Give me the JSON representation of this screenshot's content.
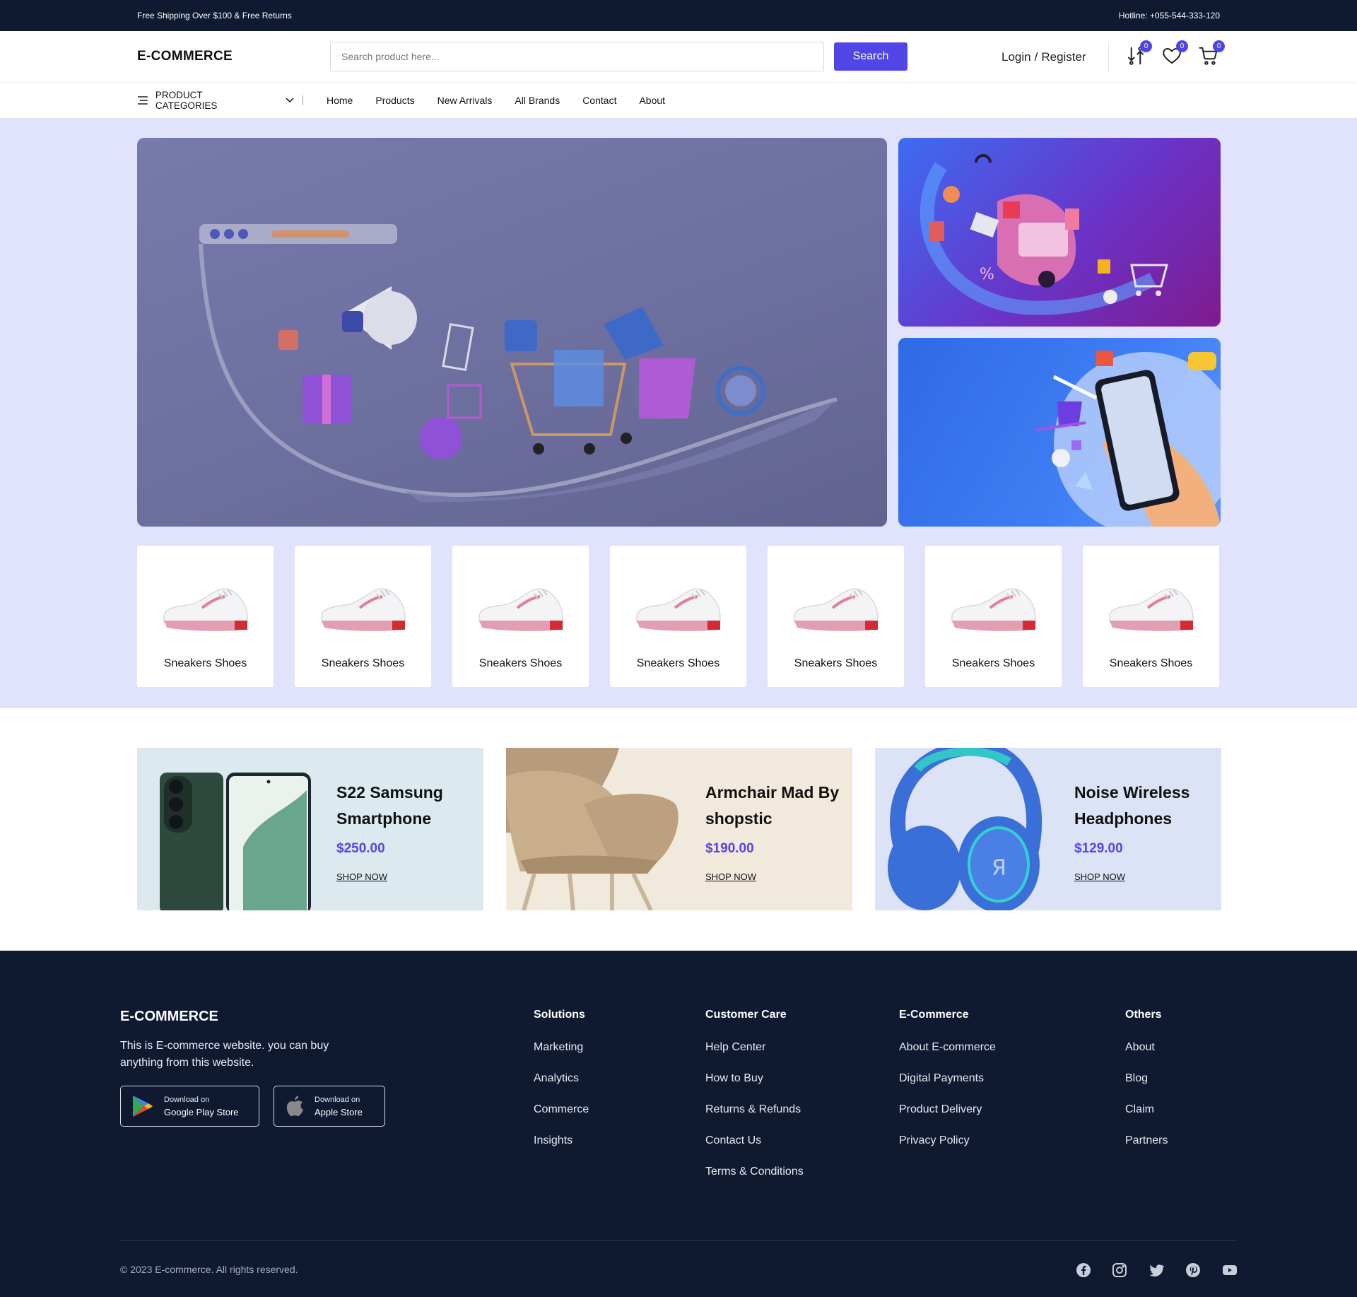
{
  "topbar": {
    "promo": "Free Shipping Over $100 & Free Returns",
    "hotline": "Hotline: +055-544-333-120"
  },
  "header": {
    "logo": "E-COMMERCE",
    "search_placeholder": "Search product here...",
    "search_button": "Search",
    "login": "Login",
    "register": "Register",
    "compare_count": "0",
    "wishlist_count": "0",
    "cart_count": "0"
  },
  "nav": {
    "categories": "PRODUCT CATEGORIES",
    "links": [
      "Home",
      "Products",
      "New Arrivals",
      "All Brands",
      "Contact",
      "About"
    ]
  },
  "category_cards": [
    {
      "label": "Sneakers Shoes"
    },
    {
      "label": "Sneakers Shoes"
    },
    {
      "label": "Sneakers Shoes"
    },
    {
      "label": "Sneakers Shoes"
    },
    {
      "label": "Sneakers Shoes"
    },
    {
      "label": "Sneakers Shoes"
    },
    {
      "label": "Sneakers Shoes"
    }
  ],
  "promos": [
    {
      "title": "S22 Samsung Smartphone",
      "price": "$250.00",
      "cta": "SHOP NOW",
      "bg": "#dceaf0"
    },
    {
      "title": "Armchair Mad By shopstic",
      "price": "$190.00",
      "cta": "SHOP NOW",
      "bg": "#f2e9dd"
    },
    {
      "title": "Noise Wireless Headphones",
      "price": "$129.00",
      "cta": "SHOP NOW",
      "bg": "#dde3f6"
    }
  ],
  "footer": {
    "logo": "E-COMMERCE",
    "description": "This is E-commerce website. you can buy anything from this website.",
    "google": {
      "small": "Download on",
      "big": "Google Play Store"
    },
    "apple": {
      "small": "Download on",
      "big": "Apple Store"
    },
    "columns": [
      {
        "title": "Solutions",
        "links": [
          "Marketing",
          "Analytics",
          "Commerce",
          "Insights"
        ]
      },
      {
        "title": "Customer Care",
        "links": [
          "Help Center",
          "How to Buy",
          "Returns & Refunds",
          "Contact Us",
          "Terms & Conditions"
        ]
      },
      {
        "title": "E-Commerce",
        "links": [
          "About E-commerce",
          "Digital Payments",
          "Product Delivery",
          "Privacy Policy"
        ]
      },
      {
        "title": "Others",
        "links": [
          "About",
          "Blog",
          "Claim",
          "Partners"
        ]
      }
    ],
    "copyright": "© 2023 E-commerce. All rights reserved.",
    "social": [
      "facebook-icon",
      "instagram-icon",
      "twitter-icon",
      "pinterest-icon",
      "youtube-icon"
    ]
  },
  "colors": {
    "accent": "#4f46e5",
    "dark": "#0f1930",
    "hero_bg": "#e0e3fb"
  }
}
